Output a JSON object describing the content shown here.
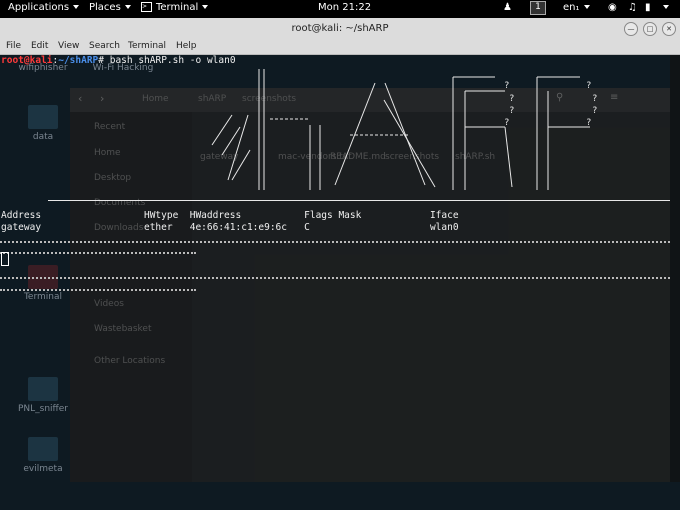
{
  "topbar": {
    "applications": "Applications",
    "places": "Places",
    "terminal": "Terminal",
    "clock": "Mon 21:22",
    "workspace": "1",
    "lang": "en₁"
  },
  "window": {
    "title": "root@kali: ~/shARP"
  },
  "menu": [
    "File",
    "Edit",
    "View",
    "Search",
    "Terminal",
    "Help"
  ],
  "desktop_icons": [
    {
      "label": "wifiphisher"
    },
    {
      "label": "Wi-Fi Hacking"
    },
    {
      "label": "data"
    },
    {
      "label": "Terminal"
    },
    {
      "label": "PNL_sniffer"
    },
    {
      "label": "evilmeta"
    }
  ],
  "filemanager": {
    "path": [
      "Home",
      "shARP",
      "screenshots"
    ],
    "sidebar": [
      "Recent",
      "Home",
      "Desktop",
      "Documents",
      "Downloads",
      "Videos",
      "Wastebasket",
      "Other Locations"
    ],
    "files": [
      "gateway",
      "mac-vendors.txt",
      "README.md",
      "screenshots",
      "shARP.sh"
    ]
  },
  "terminal": {
    "prompt_user": "root@kali",
    "prompt_sep": ":",
    "prompt_path": "~/shARP",
    "prompt_end": "# ",
    "command": "bash shARP.sh -o wlan0",
    "table_header": "Address                  HWtype  HWaddress           Flags Mask            Iface",
    "table_row": "gateway                  ether   4e:66:41:c1:e9:6c   C                     wlan0"
  }
}
